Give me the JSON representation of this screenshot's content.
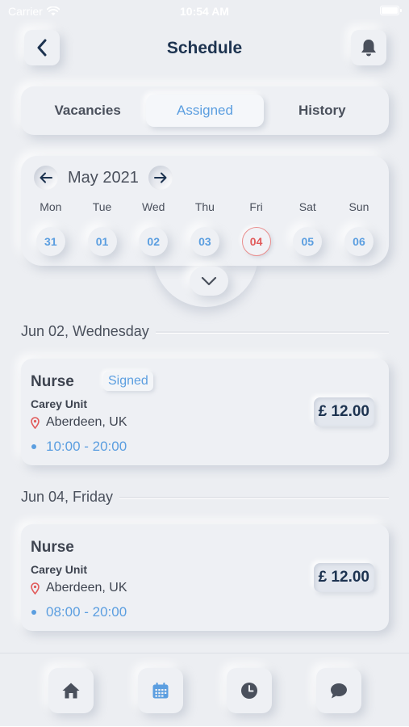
{
  "status_bar": {
    "carrier": "Carrier",
    "time": "10:54 AM"
  },
  "header": {
    "title": "Schedule",
    "back_icon": "chevron-left-icon",
    "bell_icon": "bell-icon"
  },
  "tabs": [
    {
      "label": "Vacancies",
      "active": false
    },
    {
      "label": "Assigned",
      "active": true
    },
    {
      "label": "History",
      "active": false
    }
  ],
  "calendar": {
    "month": "May 2021",
    "weekdays": [
      "Mon",
      "Tue",
      "Wed",
      "Thu",
      "Fri",
      "Sat",
      "Sun"
    ],
    "days": [
      "31",
      "01",
      "02",
      "03",
      "04",
      "05",
      "06"
    ],
    "today_index": 4
  },
  "sections": [
    {
      "date": "Jun 02, Wednesday",
      "job": {
        "title": "Nurse",
        "badge": "Signed",
        "unit": "Carey Unit",
        "location": "Aberdeen, UK",
        "time": "10:00 - 20:00",
        "price": "£ 12.00"
      }
    },
    {
      "date": "Jun 04, Friday",
      "job": {
        "title": "Nurse",
        "badge": "",
        "unit": "Carey Unit",
        "location": "Aberdeen, UK",
        "time": "08:00 - 20:00",
        "price": "£ 12.00"
      }
    }
  ],
  "bottom_nav": [
    {
      "icon": "home-icon",
      "active": false
    },
    {
      "icon": "calendar-icon",
      "active": true
    },
    {
      "icon": "clock-icon",
      "active": false
    },
    {
      "icon": "chat-icon",
      "active": false
    }
  ],
  "colors": {
    "accent": "#5b9ee0",
    "today": "#e15a5a",
    "title": "#1d3350",
    "background": "#eceef2",
    "location_pin": "#e15a5a"
  }
}
